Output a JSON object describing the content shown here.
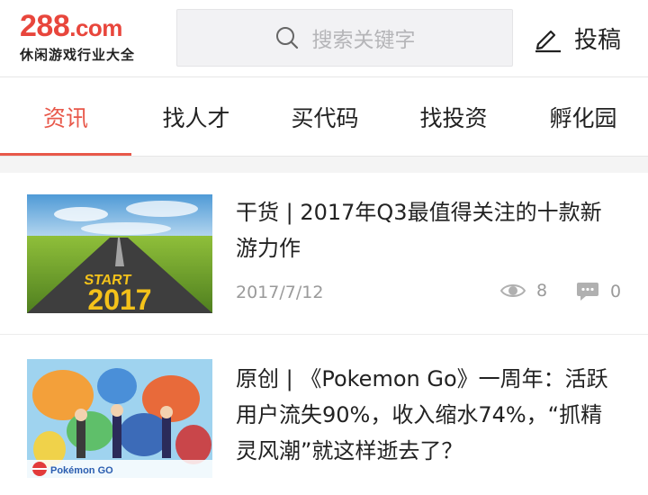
{
  "header": {
    "logo_main": "288",
    "logo_domain": ".com",
    "logo_tagline": "休闲游戏行业大全",
    "search_placeholder": "搜索关键字",
    "submit_label": "投稿"
  },
  "tabs": [
    {
      "label": "资讯",
      "active": true
    },
    {
      "label": "找人才",
      "active": false
    },
    {
      "label": "买代码",
      "active": false
    },
    {
      "label": "找投资",
      "active": false
    },
    {
      "label": "孵化园",
      "active": false
    }
  ],
  "colors": {
    "brand_red": "#e8463c",
    "active_tab": "#e8584a",
    "meta_gray": "#9a9a9a"
  },
  "articles": [
    {
      "thumb_text": "START 2017",
      "title": "干货 | 2017年Q3最值得关注的十款新游力作",
      "date": "2017/7/12",
      "views": "8",
      "comments": "0"
    },
    {
      "thumb_text": "Pokémon GO",
      "title": "原创 | 《Pokemon Go》一周年：活跃用户流失90%，收入缩水74%，“抓精灵风潮”就这样逝去了？"
    }
  ],
  "icons": {
    "search": "search-icon",
    "submit": "pen-icon",
    "views": "eye-icon",
    "comments": "comment-icon"
  }
}
